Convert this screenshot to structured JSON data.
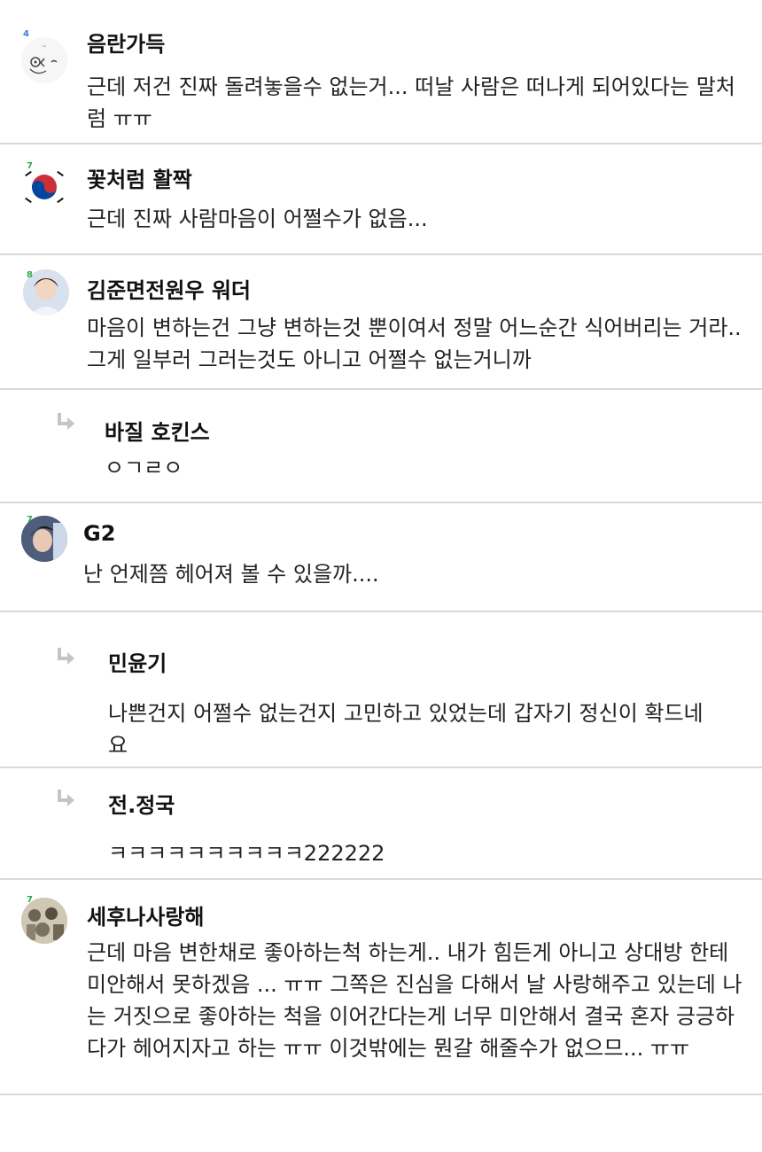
{
  "comments": [
    {
      "name": "음란가득",
      "text": "근데 저건 진짜 돌려놓을수 없는거... 떠날 사람은 떠나게 되어있다는 말처럼 ㅠㅠ",
      "level": "4",
      "level_color": "#3b7ddd"
    },
    {
      "name": "꽃처럼 활짝",
      "text": "근데 진짜 사람마음이 어쩔수가 없음...",
      "level": "7",
      "level_color": "#2fa84f"
    },
    {
      "name": "김준면전원우 워더",
      "text": "마음이 변하는건 그냥 변하는것 뿐이여서 정말 어느순간 식어버리는 거라.. 그게 일부러 그러는것도 아니고 어쩔수 없는거니까",
      "level": "8",
      "level_color": "#2fa84f"
    },
    {
      "name": "바질 호킨스",
      "text": "ㅇㄱㄹㅇ",
      "reply": true
    },
    {
      "name": "G2",
      "text": "난 언제쯤 헤어져 볼 수 있을까....",
      "level": "7",
      "level_color": "#2fa84f"
    },
    {
      "name": "민윤기",
      "text": "나쁜건지 어쩔수 없는건지 고민하고 있었는데 갑자기 정신이 확드네요",
      "reply": true
    },
    {
      "name": "전.정국",
      "text": "ㅋㅋㅋㅋㅋㅋㅋㅋㅋㅋ222222",
      "reply": true
    },
    {
      "name": "세후나사랑해",
      "text": "근데 마음 변한채로 좋아하는척 하는게.. 내가 힘든게 아니고 상대방 한테 미안해서 못하겠음 ... ㅠㅠ 그쪽은 진심을 다해서 날 사랑해주고 있는데 나는 거짓으로 좋아하는 척을 이어간다는게 너무 미안해서 결국 혼자 긍긍하다가 헤어지자고 하는 ㅠㅠ 이것밖에는 뭔갈 해줄수가 없으므... ㅠㅠ",
      "level": "7",
      "level_color": "#2fa84f"
    }
  ]
}
